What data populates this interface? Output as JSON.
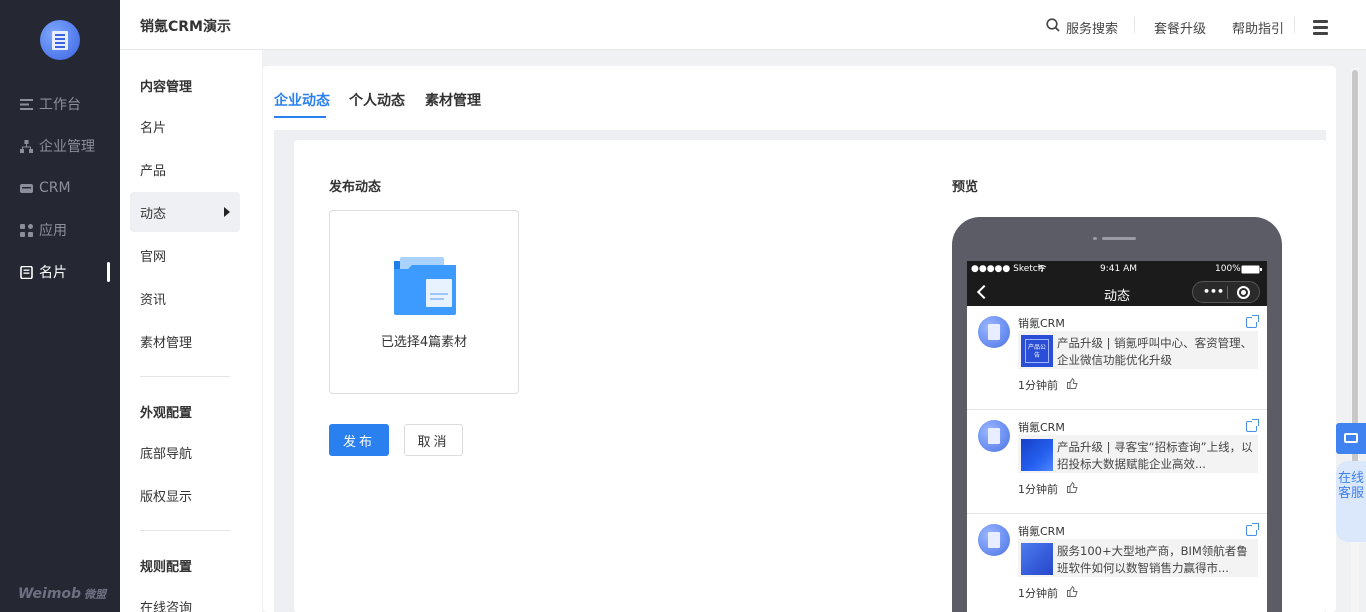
{
  "nav": {
    "items": [
      {
        "label": "工作台",
        "icon": "list-icon"
      },
      {
        "label": "企业管理",
        "icon": "org-chart-icon"
      },
      {
        "label": "CRM",
        "icon": "crm-icon"
      },
      {
        "label": "应用",
        "icon": "apps-grid-icon"
      },
      {
        "label": "名片",
        "icon": "card-icon",
        "active": true
      }
    ],
    "brand": "Weimob",
    "brand_sub": "微盟"
  },
  "header": {
    "title": "销氪CRM演示",
    "search_label": "服务搜索",
    "upgrade_label": "套餐升级",
    "help_label": "帮助指引"
  },
  "subnav": {
    "group1_title": "内容管理",
    "group1_items": [
      "名片",
      "产品",
      "动态",
      "官网",
      "资讯",
      "素材管理"
    ],
    "group2_title": "外观配置",
    "group2_items": [
      "底部导航",
      "版权显示"
    ],
    "group3_title": "规则配置",
    "group3_items": [
      "在线咨询"
    ],
    "active": "动态"
  },
  "tabs": [
    "企业动态",
    "个人动态",
    "素材管理"
  ],
  "active_tab": "企业动态",
  "publish": {
    "section_label": "发布动态",
    "selected_text": "已选择4篇素材",
    "publish_button": "发布",
    "cancel_button": "取消"
  },
  "preview": {
    "section_label": "预览",
    "status": {
      "carrier": "●●●●● Sketch",
      "time": "9:41 AM",
      "battery": "100%"
    },
    "page_title": "动态",
    "posts": [
      {
        "author": "销氪CRM",
        "text": "产品升级 | 销氪呼叫中心、客资管理、企业微信功能优化升级",
        "thumb_text": "产品公告",
        "time": "1分钟前"
      },
      {
        "author": "销氪CRM",
        "text": "产品升级 | 寻客宝“招标查询”上线，以招投标大数据赋能企业高效...",
        "thumb_text": "",
        "time": "1分钟前"
      },
      {
        "author": "销氪CRM",
        "text": "服务100+大型地产商，BIM领航者鲁班软件如何以数智销售力赢得市...",
        "thumb_text": "",
        "time": "1分钟前"
      }
    ]
  },
  "floating": {
    "service_label": "在线客服"
  },
  "colors": {
    "accent": "#2b80f0",
    "nav_bg": "#252833"
  }
}
